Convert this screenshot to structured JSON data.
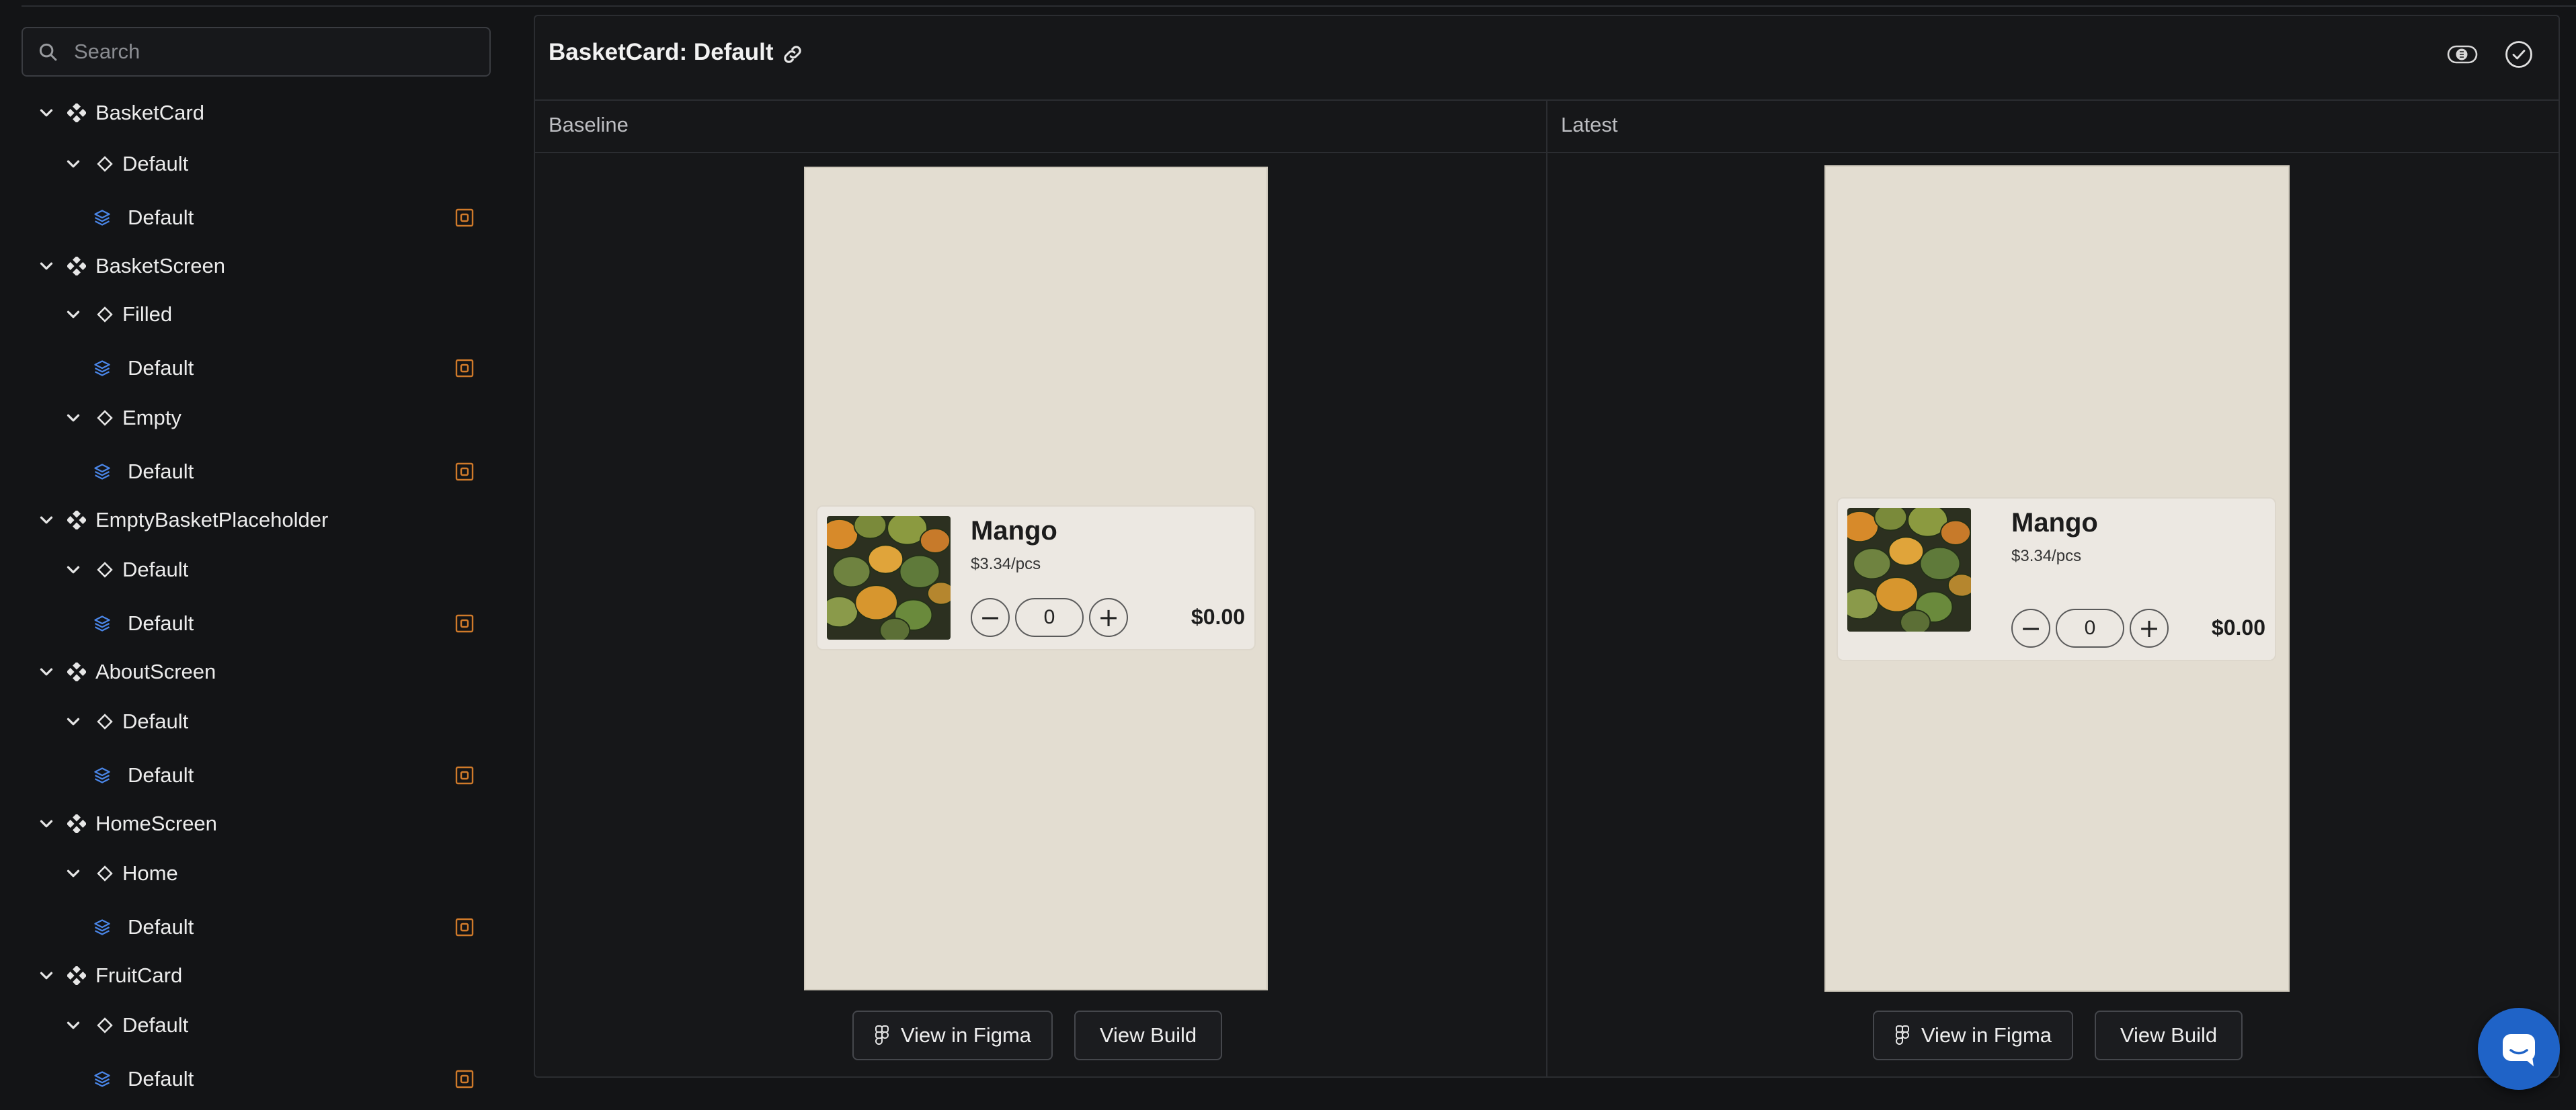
{
  "search": {
    "placeholder": "Search"
  },
  "tree": [
    {
      "level": 0,
      "label": "BasketCard"
    },
    {
      "level": 1,
      "label": "Default"
    },
    {
      "level": 2,
      "label": "Default"
    },
    {
      "level": 0,
      "label": "BasketScreen"
    },
    {
      "level": 1,
      "label": "Filled"
    },
    {
      "level": 2,
      "label": "Default"
    },
    {
      "level": 1,
      "label": "Empty"
    },
    {
      "level": 2,
      "label": "Default"
    },
    {
      "level": 0,
      "label": "EmptyBasketPlaceholder"
    },
    {
      "level": 1,
      "label": "Default"
    },
    {
      "level": 2,
      "label": "Default"
    },
    {
      "level": 0,
      "label": "AboutScreen"
    },
    {
      "level": 1,
      "label": "Default"
    },
    {
      "level": 2,
      "label": "Default"
    },
    {
      "level": 0,
      "label": "HomeScreen"
    },
    {
      "level": 1,
      "label": "Home"
    },
    {
      "level": 2,
      "label": "Default"
    },
    {
      "level": 0,
      "label": "FruitCard"
    },
    {
      "level": 1,
      "label": "Default"
    },
    {
      "level": 2,
      "label": "Default"
    }
  ],
  "panel": {
    "title": "BasketCard: Default",
    "baseline_label": "Baseline",
    "latest_label": "Latest"
  },
  "baseline": {
    "card": {
      "name": "Mango",
      "price": "$3.34/pcs",
      "qty": "0",
      "total": "$0.00",
      "minus": "−",
      "plus": "+"
    },
    "figma_label": "View in Figma",
    "build_label": "View Build"
  },
  "latest": {
    "card": {
      "name": "Mango",
      "price": "$3.34/pcs",
      "qty": "0",
      "total": "$0.00",
      "minus": "−",
      "plus": "+"
    },
    "figma_label": "View in Figma",
    "build_label": "View Build"
  },
  "colors": {
    "background": "#131416",
    "accent": "#1f63c7",
    "snapshot_icon": "#d07a2a",
    "story_icon": "#4a86e8",
    "phone_bg": "#e3ddd1"
  },
  "icons": {
    "search": "search-icon",
    "component": "component-icon",
    "variant": "diamond-icon",
    "story": "layers-icon",
    "snapshot": "snapshot-icon",
    "link": "link-icon",
    "diff_toggle": "diff-toggle-icon",
    "approve": "check-circle-icon",
    "figma": "figma-icon",
    "chat": "chat-icon"
  }
}
